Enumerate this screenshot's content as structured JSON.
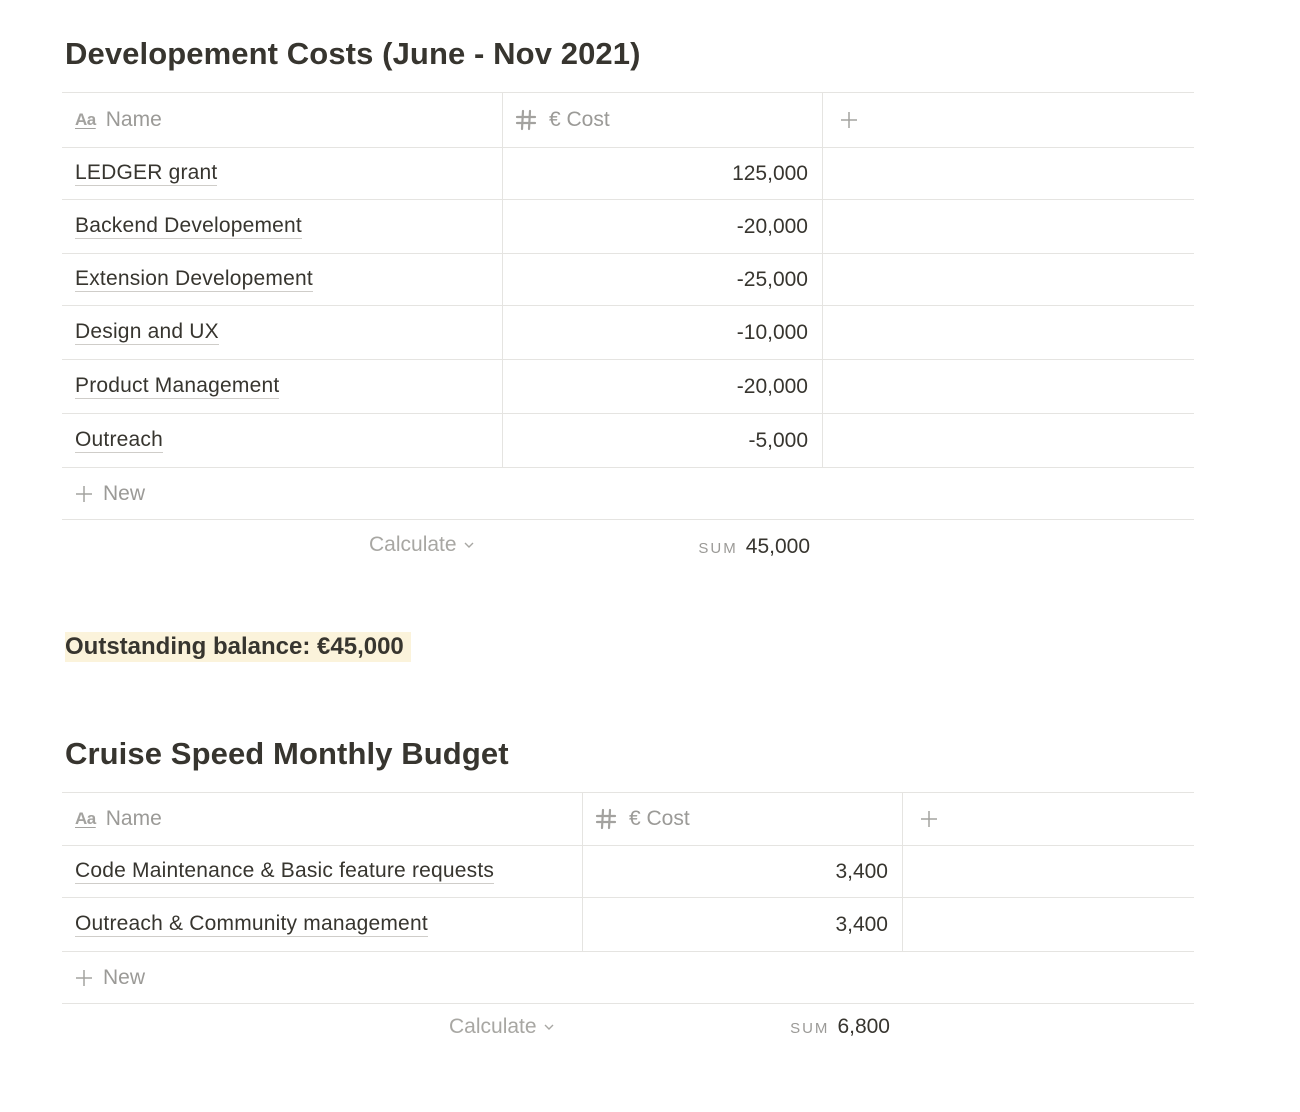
{
  "table1": {
    "title": "Developement Costs (June - Nov 2021)",
    "columns": {
      "name": "Name",
      "cost": "€ Cost"
    },
    "rows": [
      {
        "name": "LEDGER grant",
        "cost": "125,000"
      },
      {
        "name": "Backend Developement",
        "cost": "-20,000"
      },
      {
        "name": "Extension Developement",
        "cost": "-25,000"
      },
      {
        "name": "Design and UX",
        "cost": "-10,000"
      },
      {
        "name": "Product Management",
        "cost": "-20,000"
      },
      {
        "name": "Outreach",
        "cost": "-5,000"
      }
    ],
    "new_label": "New",
    "calculate_label": "Calculate",
    "sum_label": "SUM",
    "sum_value": "45,000"
  },
  "balance": {
    "text": "Outstanding balance: €45,000",
    "highlight_color": "#fbf3db"
  },
  "table2": {
    "title": "Cruise Speed Monthly Budget",
    "columns": {
      "name": "Name",
      "cost": "€ Cost"
    },
    "rows": [
      {
        "name": "Code Maintenance & Basic feature requests",
        "cost": "3,400"
      },
      {
        "name": "Outreach & Community management",
        "cost": "3,400"
      }
    ],
    "new_label": "New",
    "calculate_label": "Calculate",
    "sum_label": "SUM",
    "sum_value": "6,800"
  },
  "icons": {
    "name_column": "text-property-icon",
    "cost_column": "number-property-icon",
    "add_column": "plus-icon",
    "new_row": "plus-icon",
    "calculate": "chevron-down-icon"
  },
  "colors": {
    "text": "#37352f",
    "muted": "#9b9a97",
    "border": "#e5e4e1"
  }
}
